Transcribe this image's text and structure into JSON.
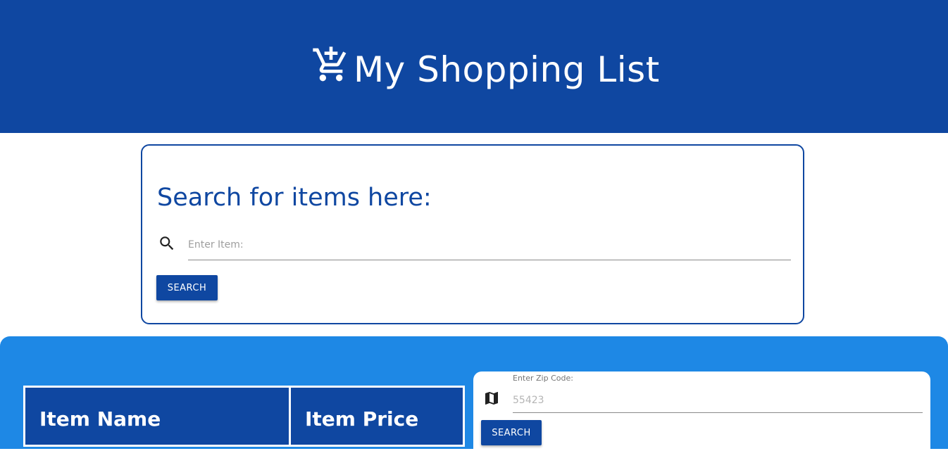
{
  "header": {
    "title": "My Shopping List",
    "icon": "add-shopping-cart-icon",
    "background_color": "#0f47a1"
  },
  "search": {
    "heading": "Search for items here:",
    "input_placeholder": "Enter Item:",
    "input_value": "",
    "button_label": "SEARCH",
    "icon": "search-icon"
  },
  "list_panel": {
    "background_color": "#1e88e5",
    "table": {
      "columns": [
        "Item Name",
        "Item Price"
      ]
    }
  },
  "zip": {
    "label": "Enter Zip Code:",
    "input_placeholder": "55423",
    "input_value": "",
    "button_label": "SEARCH",
    "icon": "map-icon"
  }
}
